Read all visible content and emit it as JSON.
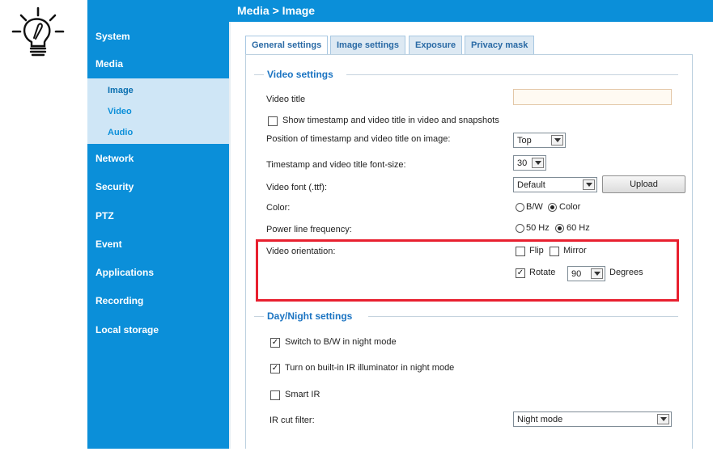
{
  "header": {
    "breadcrumb": "Media  > Image"
  },
  "sidebar": {
    "items": [
      {
        "label": "System"
      },
      {
        "label": "Media"
      },
      {
        "label": "Network"
      },
      {
        "label": "Security"
      },
      {
        "label": "PTZ"
      },
      {
        "label": "Event"
      },
      {
        "label": "Applications"
      },
      {
        "label": "Recording"
      },
      {
        "label": "Local storage"
      }
    ],
    "media_subitems": [
      {
        "label": "Image",
        "active": true
      },
      {
        "label": "Video"
      },
      {
        "label": "Audio"
      }
    ]
  },
  "tabs": [
    {
      "label": "General settings",
      "active": true
    },
    {
      "label": "Image settings"
    },
    {
      "label": "Exposure"
    },
    {
      "label": "Privacy mask"
    }
  ],
  "video_settings": {
    "title": "Video settings",
    "video_title_label": "Video title",
    "video_title_value": "",
    "show_timestamp_label": "Show timestamp and video title in video and snapshots",
    "show_timestamp_checked": false,
    "position_label": "Position of timestamp and video title on image:",
    "position_value": "Top",
    "font_size_label": "Timestamp and video title font-size:",
    "font_size_value": "30",
    "font_label": "Video font (.ttf):",
    "font_value": "Default",
    "upload_label": "Upload",
    "color_label": "Color:",
    "color_bw_label": "B/W",
    "color_color_label": "Color",
    "color_selected": "Color",
    "power_label": "Power line frequency:",
    "power_50_label": "50 Hz",
    "power_60_label": "60 Hz",
    "power_selected": "60 Hz",
    "orientation_label": "Video orientation:",
    "flip_label": "Flip",
    "flip_checked": false,
    "mirror_label": "Mirror",
    "mirror_checked": false,
    "rotate_label": "Rotate",
    "rotate_checked": true,
    "rotate_value": "90",
    "degrees_label": "Degrees"
  },
  "day_night": {
    "title": "Day/Night settings",
    "switch_bw_label": "Switch to B/W in night mode",
    "switch_bw_checked": true,
    "ir_illuminator_label": "Turn on built-in IR illuminator in night mode",
    "ir_illuminator_checked": true,
    "smart_ir_label": "Smart IR",
    "smart_ir_checked": false,
    "ir_cut_label": "IR cut filter:",
    "ir_cut_value": "Night mode"
  },
  "icons": {
    "tip": "lightbulb-tip-icon"
  },
  "colors": {
    "sidebar": "#0b8fd9",
    "section_title": "#1b74c2",
    "highlight": "#e8202f"
  },
  "checkmark": "✓"
}
